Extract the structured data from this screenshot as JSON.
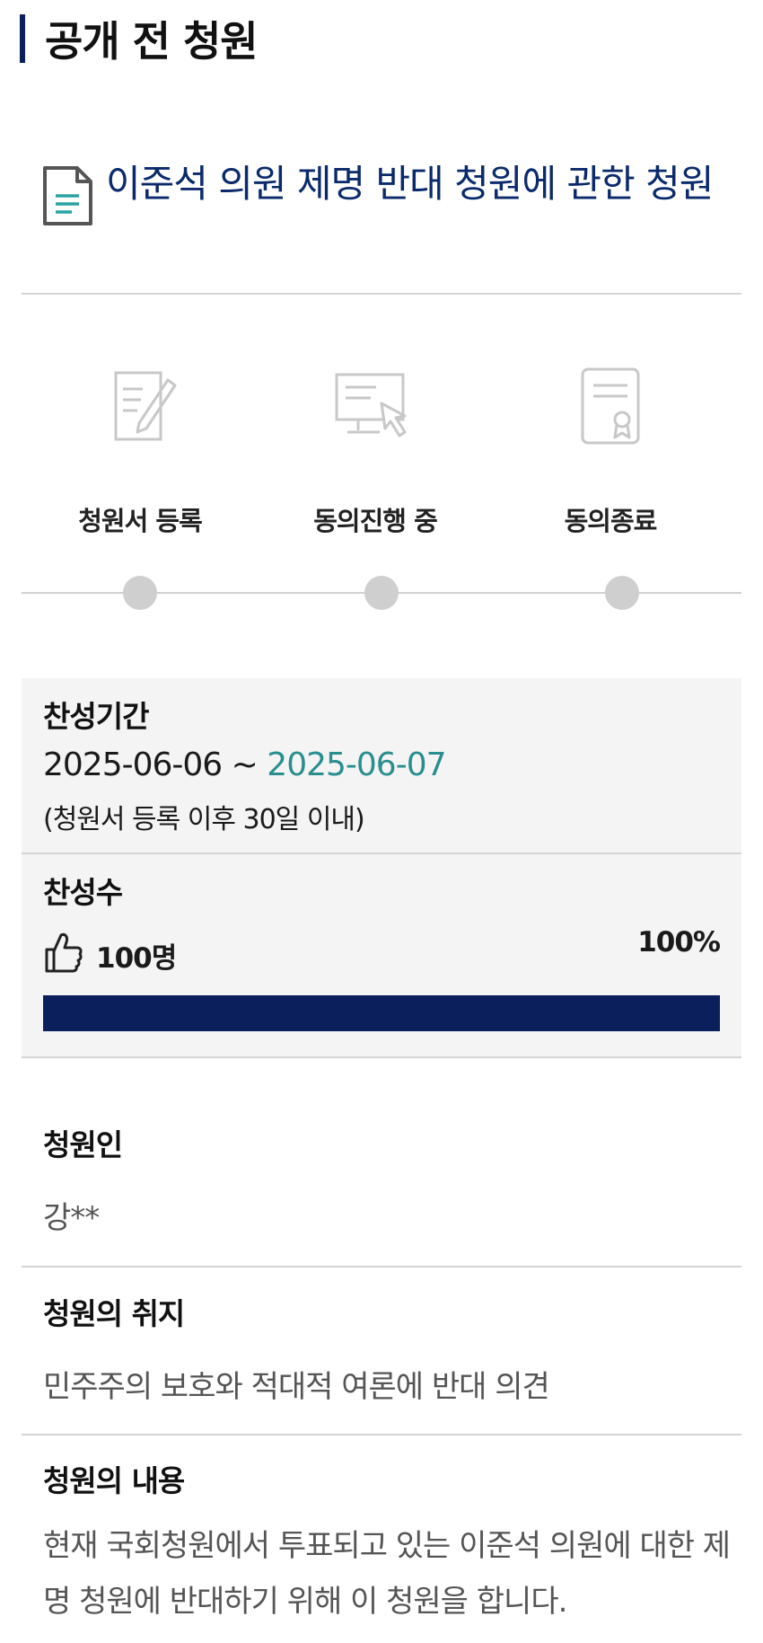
{
  "section": {
    "title": "공개 전 청원"
  },
  "petition": {
    "title": "이준석 의원 제명 반대 청원에 관한 청원"
  },
  "steps": [
    {
      "label": "청원서 등록",
      "icon": "pen-document-icon"
    },
    {
      "label": "동의진행 중",
      "icon": "computer-click-icon"
    },
    {
      "label": "동의종료",
      "icon": "certificate-icon"
    }
  ],
  "period": {
    "title": "찬성기간",
    "start": "2025-06-06",
    "separator": "~",
    "end": "2025-06-07",
    "note": "(청원서 등록 이후 30일 이내)"
  },
  "support": {
    "title": "찬성수",
    "count": "100명",
    "percent": "100%",
    "progress_fraction": 1.0
  },
  "fields": {
    "petitioner_label": "청원인",
    "petitioner_value": "강**",
    "purpose_label": "청원의 취지",
    "purpose_value": "민주주의 보호와 적대적 여론에 반대 의견",
    "content_label": "청원의 내용",
    "content_value": "현재 국회청원에서 투표되고 있는 이준석 의원에 대한 제명 청원에 반대하기 위해 이 청원을 합니다."
  },
  "colors": {
    "accent": "#0b1f5c",
    "title": "#0b2a6b",
    "date_highlight": "#2a8e8e",
    "box_bg": "#f4f4f4"
  }
}
